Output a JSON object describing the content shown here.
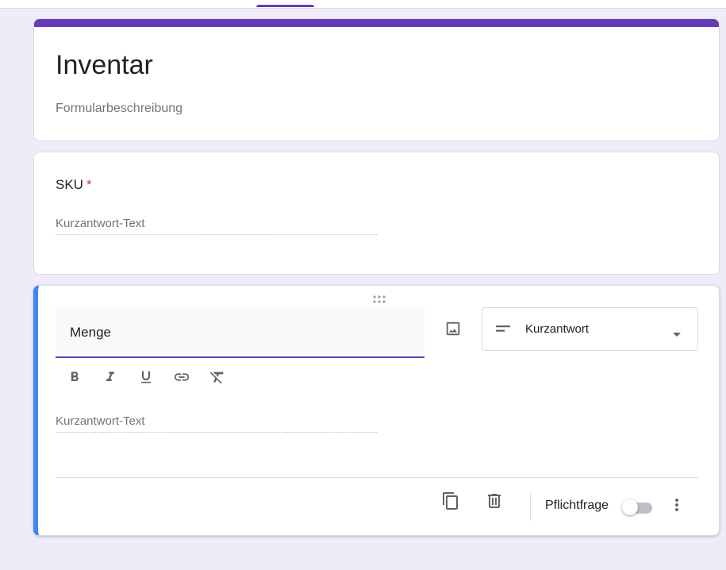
{
  "header": {
    "indicator_color": "#673ab7"
  },
  "form": {
    "title": "Inventar",
    "description_placeholder": "Formularbeschreibung"
  },
  "question1": {
    "title": "SKU",
    "required_marker": "*",
    "answer_placeholder": "Kurzantwort-Text"
  },
  "question2": {
    "title": "Menge",
    "type": "Kurzantwort",
    "answer_placeholder": "Kurzantwort-Text",
    "required_label": "Pflichtfrage",
    "required_on": false
  },
  "icons": {
    "drag": "drag-handle-icon",
    "image": "image-icon",
    "type": "short-answer-lines-icon",
    "caret": "caret-down-icon",
    "bold": "bold-icon",
    "italic": "italic-icon",
    "underline": "underline-icon",
    "link": "link-icon",
    "clear_format": "clear-formatting-icon",
    "copy": "copy-icon",
    "delete": "trash-icon",
    "more": "more-vert-icon"
  },
  "colors": {
    "accent": "#673ab7",
    "active_border": "#4285f4",
    "background": "#f0ebf8",
    "required": "#d93025"
  }
}
